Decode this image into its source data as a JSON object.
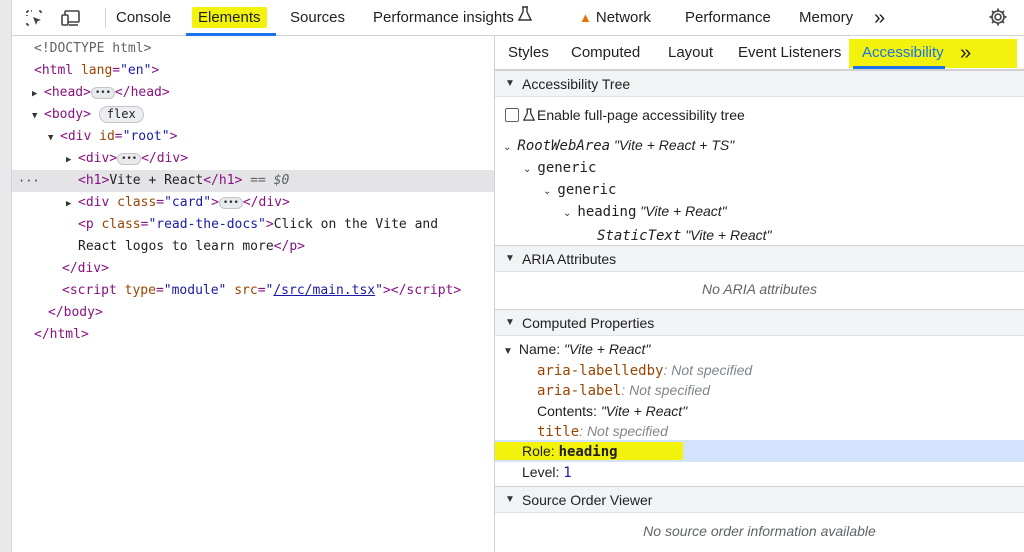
{
  "toolbar": {
    "tabs": [
      "Console",
      "Elements",
      "Sources",
      "Performance insights",
      "Network",
      "Performance",
      "Memory"
    ],
    "more": "»",
    "perf_icon": "flask-icon",
    "network_icon": "warning-icon"
  },
  "dom": {
    "doctype": "<!DOCTYPE html>",
    "html_open": "html",
    "html_lang_attr": "lang",
    "html_lang_val": "\"en\"",
    "head": "head",
    "body": "body",
    "body_badge": "flex",
    "div_root_attr": "id",
    "div_root_val": "\"root\"",
    "inner_div": "div",
    "h1_tag": "h1",
    "h1_text": "Vite + React",
    "selected_marker": "== $0",
    "card_attr": "class",
    "card_val": "\"card\"",
    "p_attr": "class",
    "p_val": "\"read-the-docs\"",
    "p_text1": "Click on the Vite and",
    "p_text2": "React logos to learn more",
    "script_type_attr": "type",
    "script_type_val": "\"module\"",
    "script_src_attr": "src",
    "script_src_val": "/src/main.tsx",
    "quote": "\""
  },
  "side_tabs": [
    "Styles",
    "Computed",
    "Layout",
    "Event Listeners",
    "Accessibility"
  ],
  "side_more": "»",
  "accessibility": {
    "tree_header": "Accessibility Tree",
    "enable_label": "Enable full-page accessibility tree",
    "tree": [
      {
        "role": "RootWebArea",
        "name": "\"Vite + React + TS\""
      },
      {
        "role": "generic",
        "name": ""
      },
      {
        "role": "generic",
        "name": ""
      },
      {
        "role": "heading",
        "name": "\"Vite + React\""
      },
      {
        "role": "StaticText",
        "name": "\"Vite + React\""
      }
    ],
    "aria_header": "ARIA Attributes",
    "aria_empty": "No ARIA attributes",
    "computed_header": "Computed Properties",
    "name_label": "Name:",
    "name_value": "\"Vite + React\"",
    "props": [
      {
        "key": "aria-labelledby",
        "value": "Not specified"
      },
      {
        "key": "aria-label",
        "value": "Not specified"
      },
      {
        "key": "Contents",
        "value": "\"Vite + React\""
      },
      {
        "key": "title",
        "value": "Not specified"
      }
    ],
    "role_label": "Role:",
    "role_value": "heading",
    "level_label": "Level:",
    "level_value": "1",
    "source_header": "Source Order Viewer",
    "source_empty": "No source order information available"
  },
  "colors": {
    "highlight": "#f2f20c",
    "accent": "#1a73e8",
    "role_row": "#d3e3fd"
  }
}
